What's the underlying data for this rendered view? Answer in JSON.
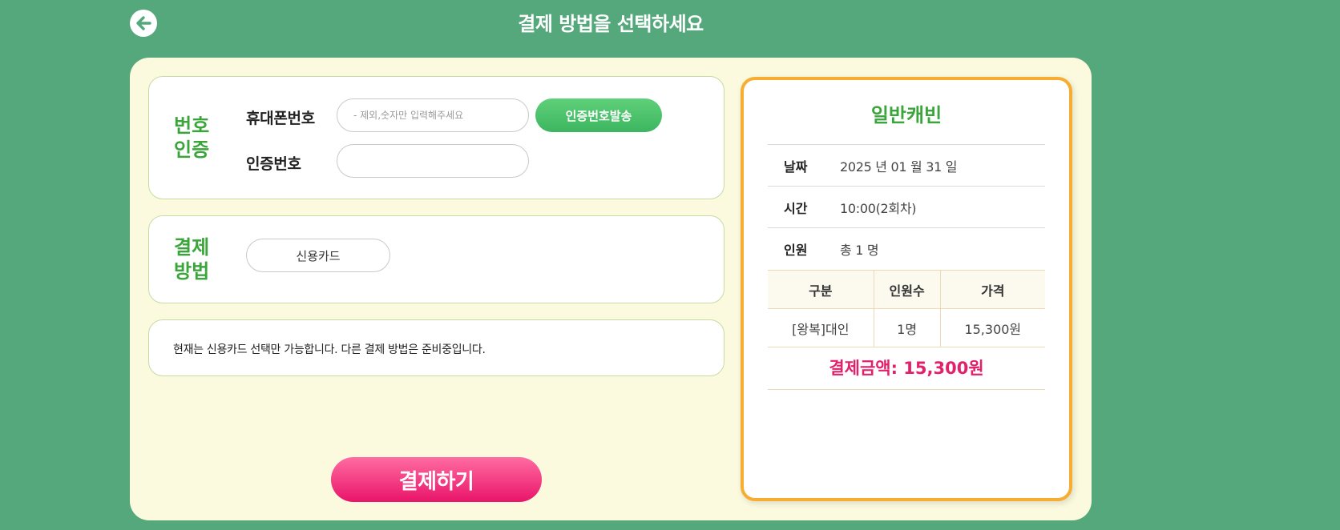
{
  "header": {
    "title": "결제 방법을 선택하세요"
  },
  "auth": {
    "title": "번호\n인증",
    "phone_label": "휴대폰번호",
    "phone_placeholder": "- 제외,숫자만 입력해주세요",
    "phone_value": "",
    "code_label": "인증번호",
    "code_value": "",
    "send_button": "인증번호발송"
  },
  "method": {
    "title": "결제\n방법",
    "option": "신용카드"
  },
  "notice": {
    "text": "현재는 신용카드 선택만 가능합니다. 다른 결제 방법은 준비중입니다."
  },
  "pay_button": "결제하기",
  "summary": {
    "title": "일반캐빈",
    "rows": [
      {
        "key": "날짜",
        "value": "2025 년 01 월 31 일"
      },
      {
        "key": "시간",
        "value": "10:00(2회차)"
      },
      {
        "key": "인원",
        "value": "총 1 명"
      }
    ],
    "table": {
      "headers": [
        "구분",
        "인원수",
        "가격"
      ],
      "rows": [
        [
          "[왕복]대인",
          "1명",
          "15,300원"
        ]
      ]
    },
    "total": "결제금액: 15,300원"
  },
  "colors": {
    "background": "#55a77c",
    "panel": "#fbfade",
    "accent_green": "#3aa53a",
    "accent_pink": "#e9146a",
    "summary_border": "#f7ad32"
  },
  "icons": {
    "back": "arrow-left-icon"
  }
}
